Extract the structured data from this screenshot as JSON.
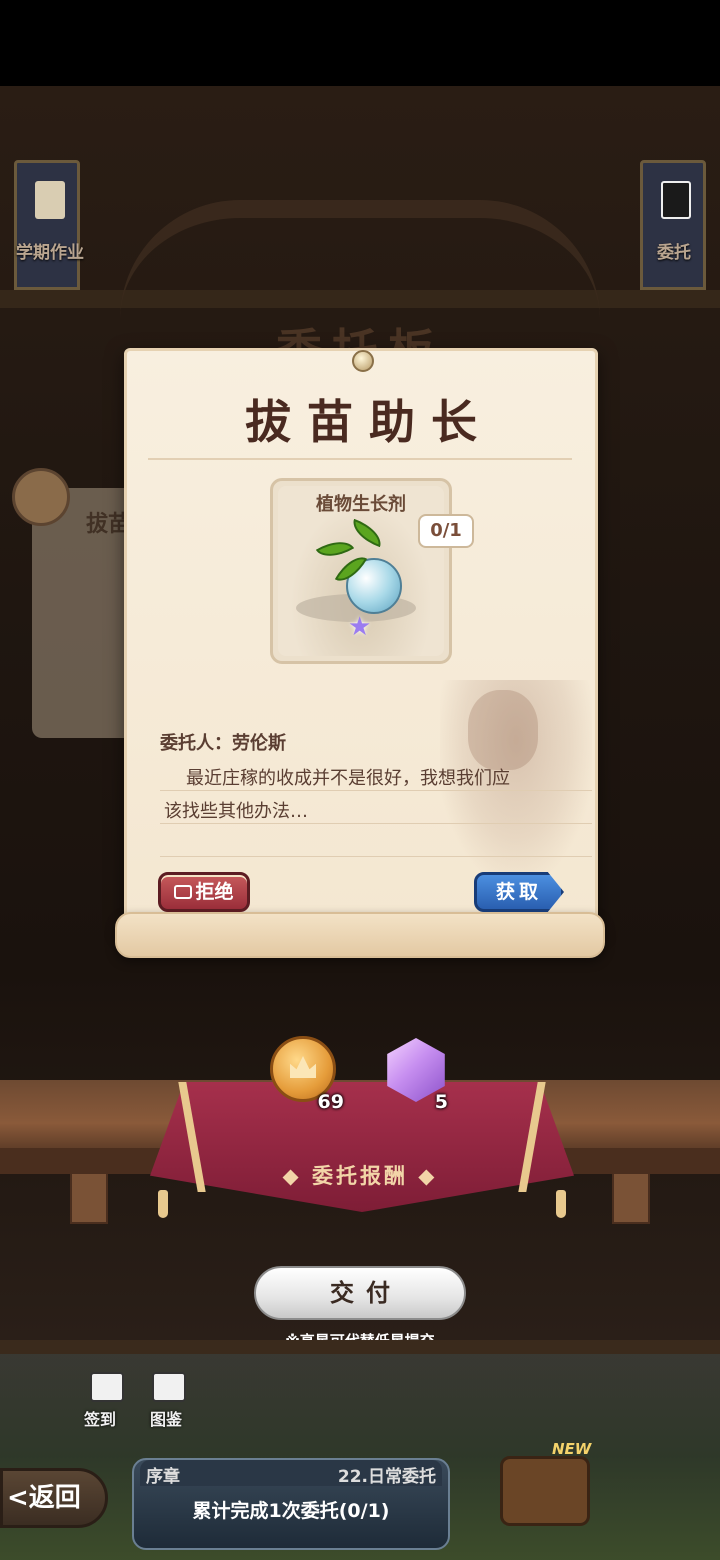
{
  "background": {
    "scene_title": "委托板",
    "left_banner": {
      "label": "学期作业",
      "icon": "scroll-icon"
    },
    "right_banner": {
      "label": "委托",
      "icon": "qr-board-icon"
    },
    "behind_card_title": "拔苗"
  },
  "dialog": {
    "title": "拔苗助长",
    "item": {
      "name": "植物生长剂",
      "count": "0/1",
      "icon": "plant-potion-icon"
    },
    "requester_line": "委托人：劳伦斯",
    "description_line1": "最近庄稼的收成并不是很好，我想我们应",
    "description_line2": "该找些其他办法…",
    "reject_label": "拒绝",
    "acquire_label": "获取"
  },
  "rewards": {
    "label": "委托报酬",
    "items": [
      {
        "icon": "gold-coin-icon",
        "count": "69"
      },
      {
        "icon": "purple-gem-icon",
        "count": "5"
      }
    ]
  },
  "submit": {
    "label": "交付",
    "hint": "※高星可代替低星提交"
  },
  "bottom": {
    "checkin_label": "签到",
    "atlas_label": "图鉴",
    "back_label": "返回",
    "quest": {
      "chapter": "序章",
      "name": "22.日常委托",
      "description": "累计完成1次委托(0/1)"
    },
    "new_tag": "NEW"
  },
  "colors": {
    "parchment": "#f6ecda",
    "title_text": "#4a2a20",
    "reject_button": "#b0404c",
    "acquire_button": "#3a78cc",
    "reward_cloth": "#a6304c"
  }
}
